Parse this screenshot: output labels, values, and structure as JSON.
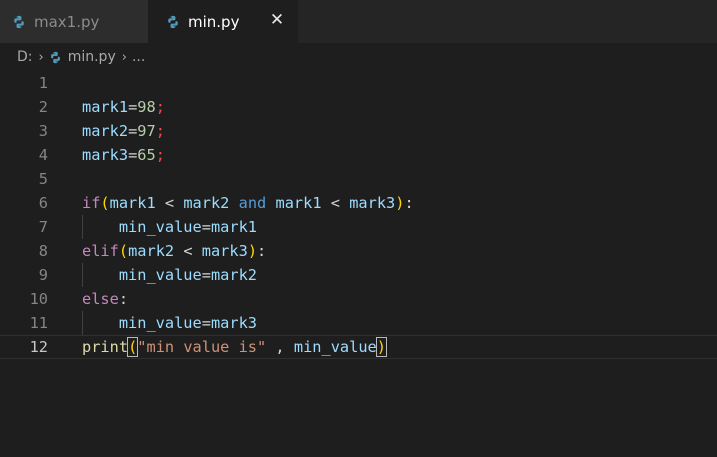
{
  "tabs": [
    {
      "label": "max1.py",
      "active": false
    },
    {
      "label": "min.py",
      "active": true
    }
  ],
  "tab_close_glyph": "✕",
  "breadcrumb": {
    "drive": "D:",
    "file": "min.py",
    "more": "..."
  },
  "colors": {
    "background": "#1e1e1e",
    "tabbar": "#252526",
    "python_icon": "#519aba",
    "variable": "#9cdcfe",
    "keyword": "#c586c0",
    "and_keyword": "#569cd6",
    "function": "#dcdcaa",
    "string": "#ce9178",
    "number": "#b5cea8",
    "semicolon": "#f14c4c",
    "bracket": "#ffd700"
  },
  "current_line": 12,
  "code_lines": [
    {
      "n": "1",
      "tokens": []
    },
    {
      "n": "2",
      "tokens": [
        {
          "t": "mark1",
          "k": "var"
        },
        {
          "t": "=",
          "k": "op"
        },
        {
          "t": "98",
          "k": "num"
        },
        {
          "t": ";",
          "k": "semi"
        }
      ]
    },
    {
      "n": "3",
      "tokens": [
        {
          "t": "mark2",
          "k": "var"
        },
        {
          "t": "=",
          "k": "op"
        },
        {
          "t": "97",
          "k": "num"
        },
        {
          "t": ";",
          "k": "semi"
        }
      ]
    },
    {
      "n": "4",
      "tokens": [
        {
          "t": "mark3",
          "k": "var"
        },
        {
          "t": "=",
          "k": "op"
        },
        {
          "t": "65",
          "k": "num"
        },
        {
          "t": ";",
          "k": "semi"
        }
      ]
    },
    {
      "n": "5",
      "tokens": []
    },
    {
      "n": "6",
      "tokens": [
        {
          "t": "if",
          "k": "kw"
        },
        {
          "t": "(",
          "k": "br"
        },
        {
          "t": "mark1",
          "k": "var"
        },
        {
          "t": " < ",
          "k": "op"
        },
        {
          "t": "mark2",
          "k": "var"
        },
        {
          "t": " ",
          "k": "op"
        },
        {
          "t": "and",
          "k": "and"
        },
        {
          "t": " ",
          "k": "op"
        },
        {
          "t": "mark1",
          "k": "var"
        },
        {
          "t": " < ",
          "k": "op"
        },
        {
          "t": "mark3",
          "k": "var"
        },
        {
          "t": ")",
          "k": "br"
        },
        {
          "t": ":",
          "k": "op"
        }
      ]
    },
    {
      "n": "7",
      "indent": true,
      "tokens": [
        {
          "t": "    ",
          "k": "op"
        },
        {
          "t": "min_value",
          "k": "var"
        },
        {
          "t": "=",
          "k": "op"
        },
        {
          "t": "mark1",
          "k": "var"
        }
      ]
    },
    {
      "n": "8",
      "tokens": [
        {
          "t": "elif",
          "k": "kw"
        },
        {
          "t": "(",
          "k": "br"
        },
        {
          "t": "mark2",
          "k": "var"
        },
        {
          "t": " < ",
          "k": "op"
        },
        {
          "t": "mark3",
          "k": "var"
        },
        {
          "t": ")",
          "k": "br"
        },
        {
          "t": ":",
          "k": "op"
        }
      ]
    },
    {
      "n": "9",
      "indent": true,
      "tokens": [
        {
          "t": "    ",
          "k": "op"
        },
        {
          "t": "min_value",
          "k": "var"
        },
        {
          "t": "=",
          "k": "op"
        },
        {
          "t": "mark2",
          "k": "var"
        }
      ]
    },
    {
      "n": "10",
      "tokens": [
        {
          "t": "else",
          "k": "kw"
        },
        {
          "t": ":",
          "k": "op"
        }
      ]
    },
    {
      "n": "11",
      "indent": true,
      "tokens": [
        {
          "t": "    ",
          "k": "op"
        },
        {
          "t": "min_value",
          "k": "var"
        },
        {
          "t": "=",
          "k": "op"
        },
        {
          "t": "mark3",
          "k": "var"
        }
      ]
    },
    {
      "n": "12",
      "tokens": [
        {
          "t": "print",
          "k": "fn"
        },
        {
          "t": "(",
          "k": "br-match"
        },
        {
          "t": "\"min value is\"",
          "k": "str"
        },
        {
          "t": " , ",
          "k": "op"
        },
        {
          "t": "min_value",
          "k": "var"
        },
        {
          "t": ")",
          "k": "br-match"
        }
      ]
    }
  ]
}
